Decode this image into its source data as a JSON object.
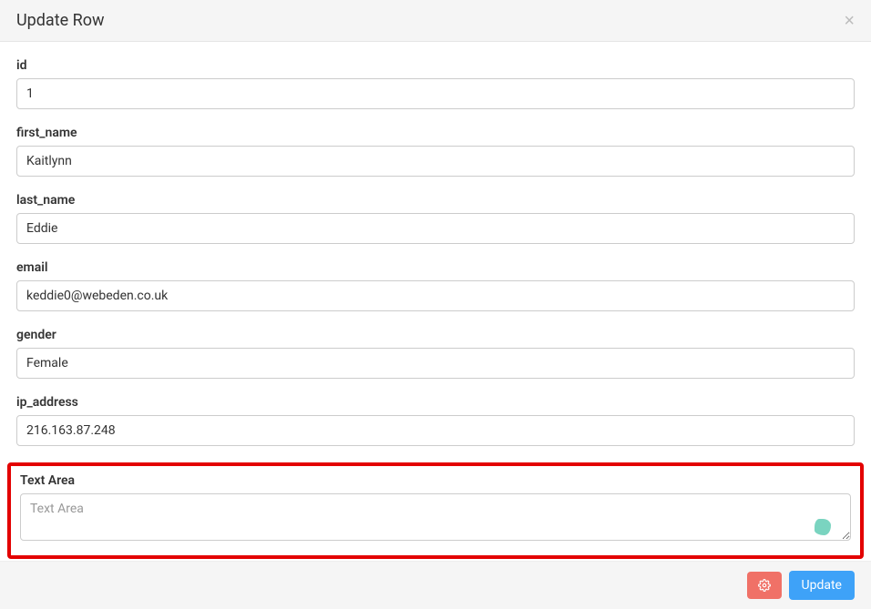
{
  "header": {
    "title": "Update Row"
  },
  "fields": {
    "id": {
      "label": "id",
      "value": "1"
    },
    "first_name": {
      "label": "first_name",
      "value": "Kaitlynn"
    },
    "last_name": {
      "label": "last_name",
      "value": "Eddie"
    },
    "email": {
      "label": "email",
      "value": "keddie0@webeden.co.uk"
    },
    "gender": {
      "label": "gender",
      "value": "Female"
    },
    "ip_address": {
      "label": "ip_address",
      "value": "216.163.87.248"
    },
    "text_area": {
      "label": "Text Area",
      "placeholder": "Text Area",
      "value": ""
    }
  },
  "footer": {
    "update_label": "Update"
  }
}
